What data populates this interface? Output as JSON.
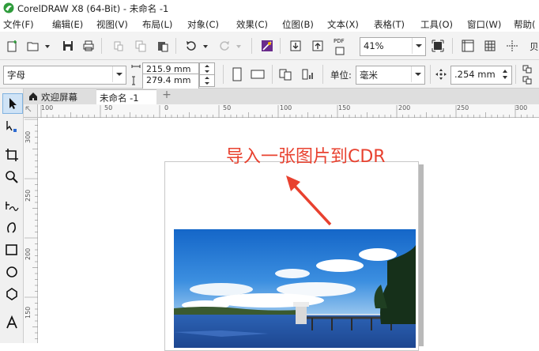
{
  "window": {
    "title": "CorelDRAW X8 (64-Bit) - 未命名 -1"
  },
  "menu": [
    "文件(F)",
    "编辑(E)",
    "视图(V)",
    "布局(L)",
    "对象(C)",
    "效果(C)",
    "位图(B)",
    "文本(X)",
    "表格(T)",
    "工具(O)",
    "窗口(W)",
    "帮助("
  ],
  "toolbar1": {
    "zoom_value": "41%",
    "pdf_label": "PDF",
    "truncated_label": "贝"
  },
  "toolbar2": {
    "paper_preset": "字母",
    "width_value": "215.9 mm",
    "height_value": "279.4 mm",
    "units_label": "单位:",
    "units_value": "毫米",
    "nudge_value": ".254 mm"
  },
  "tabs": {
    "home_label": "欢迎屏幕",
    "doc_label": "未命名 -1",
    "add_label": "+"
  },
  "rulers": {
    "h_labels": [
      "100",
      "50",
      "0",
      "50",
      "100",
      "150",
      "200",
      "250",
      "300"
    ],
    "v_labels": [
      "300",
      "250",
      "200",
      "150"
    ]
  },
  "canvas": {
    "annotation": "导入一张图片到CDR"
  },
  "colors": {
    "annotation": "#e8412f",
    "toolbar_bg": "#f3f3f3",
    "sky": "#1f7fd9",
    "water": "#2a5fb0"
  }
}
